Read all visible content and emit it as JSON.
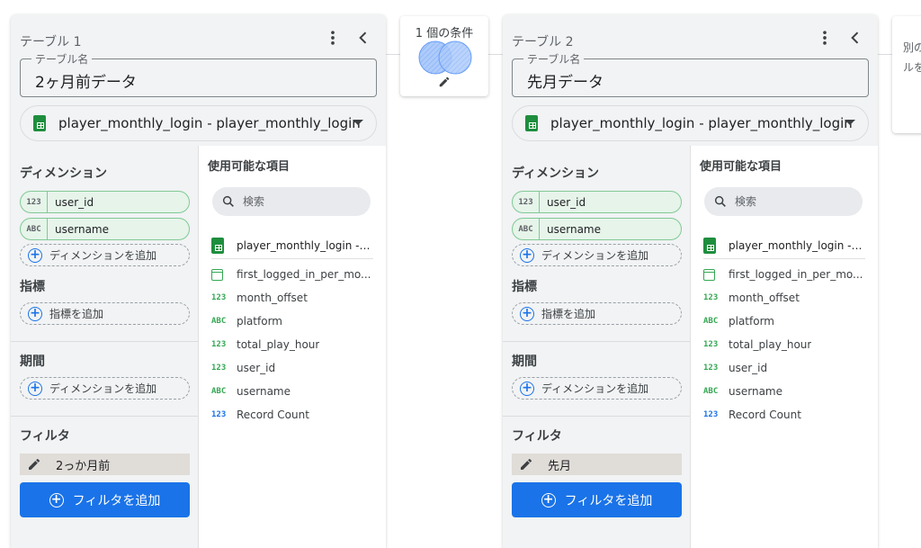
{
  "join": {
    "condition_label": "1 個の条件"
  },
  "next_panel": {
    "line1": "別の",
    "line2": "ルを"
  },
  "tables": [
    {
      "title": "テーブル 1",
      "name_legend": "テーブル名",
      "name_value": "2ヶ月前データ",
      "source": "player_monthly_login - player_monthly_login",
      "dimensions_label": "ディメンション",
      "dimensions": [
        {
          "type": "123",
          "name": "user_id"
        },
        {
          "type": "ABC",
          "name": "username"
        }
      ],
      "add_dimension_label": "ディメンションを追加",
      "metrics_label": "指標",
      "add_metric_label": "指標を追加",
      "period_label": "期間",
      "add_period_label": "ディメンションを追加",
      "filter_label": "フィルタ",
      "filter_value": "2っか月前",
      "add_filter_label": "フィルタを追加",
      "available_label": "使用可能な項目",
      "search_placeholder": "検索",
      "source_field": "player_monthly_login - p...",
      "fields": [
        {
          "type": "cal",
          "name": "first_logged_in_per_mo..."
        },
        {
          "type": "123",
          "name": "month_offset"
        },
        {
          "type": "ABC",
          "name": "platform"
        },
        {
          "type": "123",
          "name": "total_play_hour"
        },
        {
          "type": "123",
          "name": "user_id"
        },
        {
          "type": "ABC",
          "name": "username"
        },
        {
          "type": "123b",
          "name": "Record Count"
        }
      ]
    },
    {
      "title": "テーブル 2",
      "name_legend": "テーブル名",
      "name_value": "先月データ",
      "source": "player_monthly_login - player_monthly_login",
      "dimensions_label": "ディメンション",
      "dimensions": [
        {
          "type": "123",
          "name": "user_id"
        },
        {
          "type": "ABC",
          "name": "username"
        }
      ],
      "add_dimension_label": "ディメンションを追加",
      "metrics_label": "指標",
      "add_metric_label": "指標を追加",
      "period_label": "期間",
      "add_period_label": "ディメンションを追加",
      "filter_label": "フィルタ",
      "filter_value": "先月",
      "add_filter_label": "フィルタを追加",
      "available_label": "使用可能な項目",
      "search_placeholder": "検索",
      "source_field": "player_monthly_login - p...",
      "fields": [
        {
          "type": "cal",
          "name": "first_logged_in_per_mo..."
        },
        {
          "type": "123",
          "name": "month_offset"
        },
        {
          "type": "ABC",
          "name": "platform"
        },
        {
          "type": "123",
          "name": "total_play_hour"
        },
        {
          "type": "123",
          "name": "user_id"
        },
        {
          "type": "ABC",
          "name": "username"
        },
        {
          "type": "123b",
          "name": "Record Count"
        }
      ]
    }
  ]
}
